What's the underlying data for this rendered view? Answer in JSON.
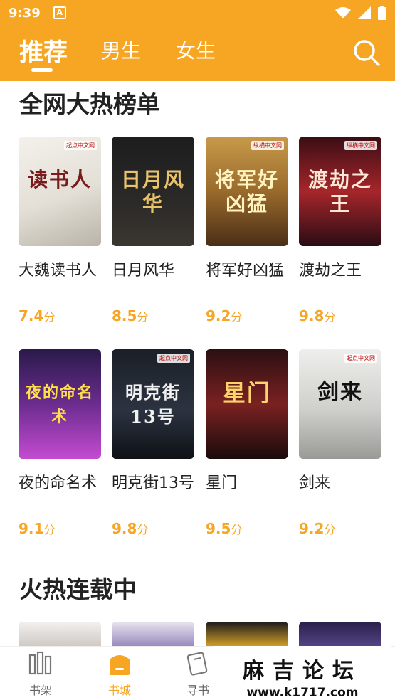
{
  "status_bar": {
    "time": "9:39",
    "app_icon": "A"
  },
  "header": {
    "tabs": [
      {
        "label": "推荐",
        "active": true
      },
      {
        "label": "男生",
        "active": false
      },
      {
        "label": "女生",
        "active": false
      }
    ],
    "search_icon": "search-icon",
    "accent_color": "#f6a623"
  },
  "sections": [
    {
      "title": "全网大热榜单",
      "books": [
        {
          "title": "大魏读书人",
          "cover_text": "读书人",
          "score": "7.4",
          "unit": "分"
        },
        {
          "title": "日月风华",
          "cover_text": "日月风华",
          "score": "8.5",
          "unit": "分"
        },
        {
          "title": "将军好凶猛",
          "cover_text": "将军好凶猛",
          "score": "9.2",
          "unit": "分"
        },
        {
          "title": "渡劫之王",
          "cover_text": "渡劫之王",
          "score": "9.8",
          "unit": "分"
        },
        {
          "title": "夜的命名术",
          "cover_text": "夜的命名术",
          "score": "9.1",
          "unit": "分"
        },
        {
          "title": "明克街13号",
          "cover_text": "明克街13号",
          "score": "9.8",
          "unit": "分"
        },
        {
          "title": "星门",
          "cover_text": "星门",
          "score": "9.5",
          "unit": "分"
        },
        {
          "title": "剑来",
          "cover_text": "剑来",
          "score": "9.2",
          "unit": "分"
        }
      ]
    },
    {
      "title": "火热连载中"
    }
  ],
  "bottom_nav": [
    {
      "label": "书架",
      "icon": "bookshelf-icon",
      "active": false
    },
    {
      "label": "书城",
      "icon": "bookstore-icon",
      "active": true
    },
    {
      "label": "寻书",
      "icon": "find-book-icon",
      "active": false
    }
  ],
  "watermark": {
    "line1": "麻吉论坛",
    "line2": "www.k1717.com"
  }
}
